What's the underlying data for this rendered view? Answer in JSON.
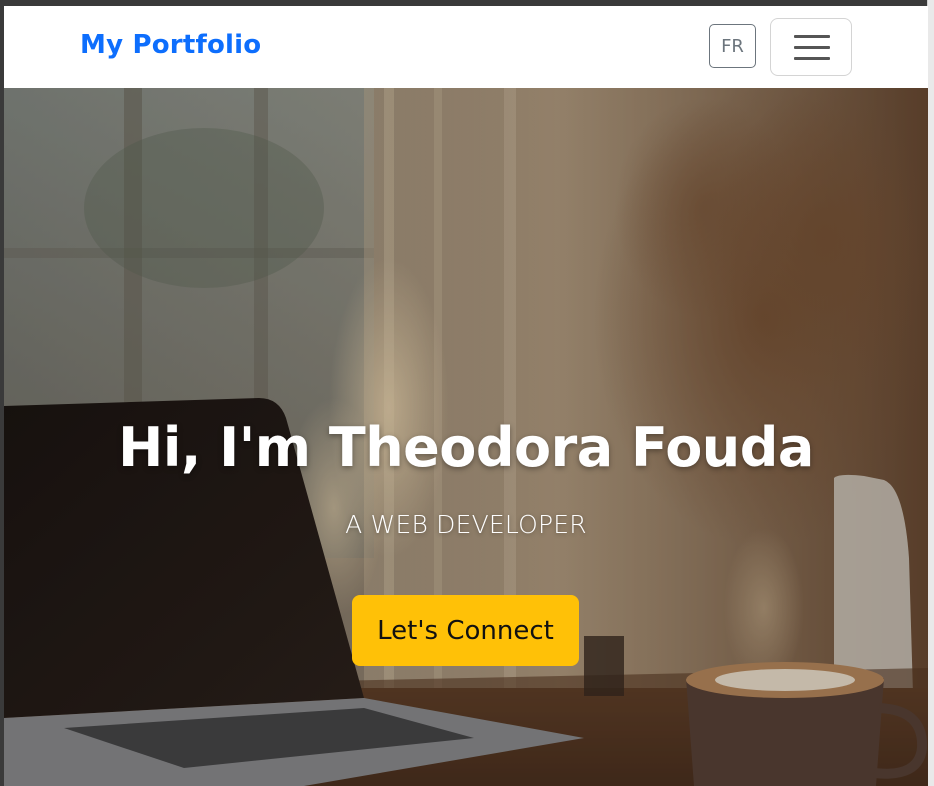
{
  "navbar": {
    "brand": "My Portfolio",
    "language_button": "FR",
    "menu_toggle_icon": "hamburger-menu-icon"
  },
  "hero": {
    "title": "Hi, I'm Theodora Fouda",
    "subtitle": "A WEB DEVELOPER",
    "cta_label": "Let's Connect"
  },
  "colors": {
    "brand": "#0d6efd",
    "cta": "#ffc107",
    "secondary": "#6c757d"
  }
}
